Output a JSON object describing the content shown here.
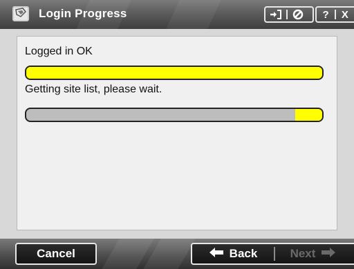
{
  "window": {
    "title": "Login Progress",
    "buttons": {
      "help_label": "?",
      "close_label": "X"
    }
  },
  "progress": {
    "login_status": "Logged in OK",
    "login_progress": 1.0,
    "site_status": "Getting site list, please wait.",
    "site_progress_segment": [
      0.91,
      1.0
    ]
  },
  "footer": {
    "cancel_label": "Cancel",
    "back_label": "Back",
    "next_label": "Next"
  },
  "colors": {
    "progress_fill": "#ffff00",
    "progress_track": "#bdbdbd",
    "disabled_text": "#6a6a6a"
  }
}
